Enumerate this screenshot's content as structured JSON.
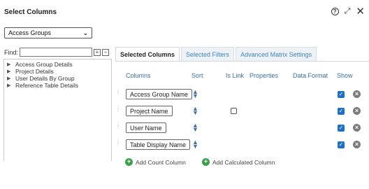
{
  "dialog": {
    "title": "Select Columns",
    "help_glyph": "?",
    "expand_glyph": "⤢",
    "close_glyph": "✕"
  },
  "group_select": {
    "value": "Access Groups",
    "chevron": "⌄"
  },
  "find": {
    "label": "Find:",
    "value": "",
    "expand_glyph": "+",
    "collapse_glyph": "−"
  },
  "tree": {
    "items": [
      {
        "label": "Access Group Details"
      },
      {
        "label": "Project Details"
      },
      {
        "label": "User Details By Group"
      },
      {
        "label": "Reference Table Details"
      }
    ]
  },
  "tabs": [
    {
      "label": "Selected Columns",
      "active": true
    },
    {
      "label": "Selected Filters",
      "active": false
    },
    {
      "label": "Advanced Matrix Settings",
      "active": false
    }
  ],
  "table": {
    "headers": {
      "columns": "Columns",
      "sort": "Sort",
      "is_link": "Is Link",
      "properties": "Properties",
      "data_format": "Data Format",
      "show": "Show"
    },
    "rows": [
      {
        "name": "Access Group Name",
        "is_link_visible": false,
        "show": true
      },
      {
        "name": "Project Name",
        "is_link_visible": true,
        "is_link": false,
        "show": true
      },
      {
        "name": "User Name",
        "is_link_visible": false,
        "show": true
      },
      {
        "name": "Table Display Name",
        "is_link_visible": false,
        "show": true
      }
    ]
  },
  "actions": {
    "add_count": "Add Count Column",
    "add_calculated": "Add Calculated Column"
  },
  "colors": {
    "link": "#3a87c0",
    "checkbox": "#1f6fc6",
    "add": "#3aa14a"
  }
}
